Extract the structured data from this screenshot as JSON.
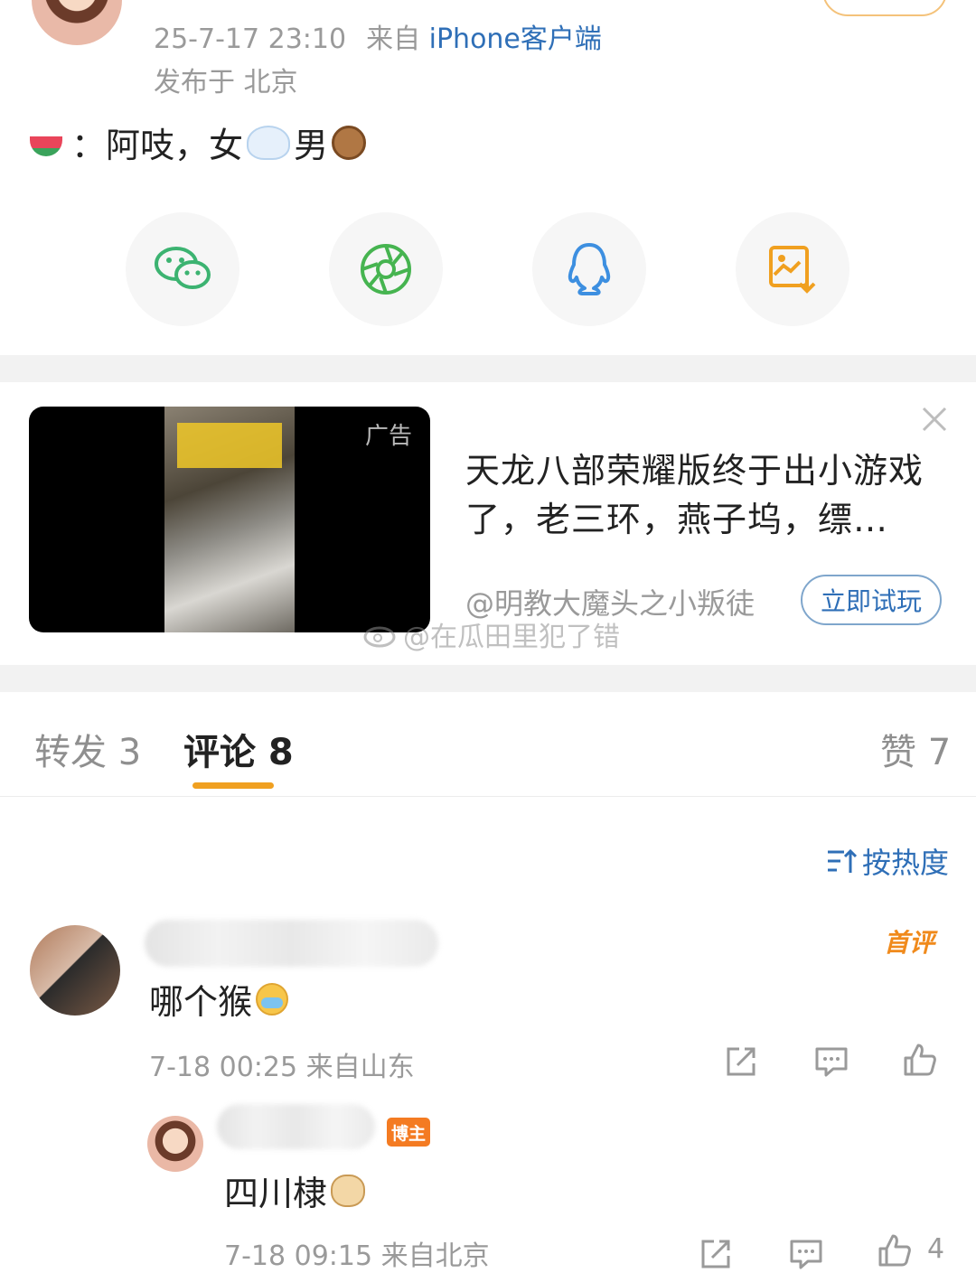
{
  "post": {
    "time": "25-7-17 23:10",
    "source_prefix": "来自",
    "source": "iPhone客户端",
    "location": "发布于 北京",
    "text_a": "：阿吱，女",
    "text_b": "男",
    "emojis": [
      "watermelon-emoji",
      "swan-emoji",
      "monkey-emoji"
    ]
  },
  "share": {
    "items": [
      {
        "icon": "wechat-icon",
        "color": "#3cb371"
      },
      {
        "icon": "moments-icon",
        "color": "#46b450"
      },
      {
        "icon": "qq-icon",
        "color": "#3d8fe0"
      },
      {
        "icon": "save-image-icon",
        "color": "#f0a020"
      }
    ]
  },
  "ad": {
    "badge": "广告",
    "title": "天龙八部荣耀版终于出小游戏了，老三环，燕子坞，缥…",
    "author": "@明教大魔头之小叛徒",
    "cta": "立即试玩",
    "watermark": "@在瓜田里犯了错"
  },
  "tabs": {
    "repost": "转发 3",
    "comments": "评论 8",
    "likes": "赞 7"
  },
  "sort_label": "按热度",
  "comment": {
    "badge": "首评",
    "text": "哪个猴",
    "meta": "7-18 00:25  来自山东"
  },
  "reply": {
    "badge": "博主",
    "text": "四川棣",
    "meta": "7-18 09:15  来自北京",
    "likes": "4"
  },
  "colors": {
    "link": "#2f6fb7",
    "accent": "#f0a020",
    "meta": "#9a9a9a"
  }
}
